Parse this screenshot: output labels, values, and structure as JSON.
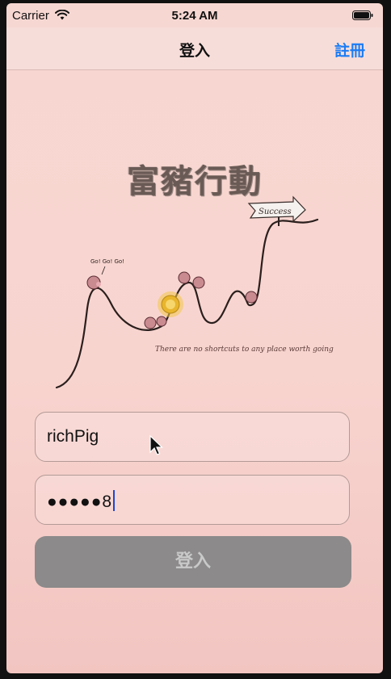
{
  "status_bar": {
    "carrier": "Carrier",
    "time": "5:24 AM",
    "wifi_icon": "wifi-icon",
    "battery_icon": "battery-icon"
  },
  "nav": {
    "title": "登入",
    "register_label": "註冊"
  },
  "illustration": {
    "title": "富豬行動",
    "sign_text": "Success",
    "speech_text": "Go! Go! Go!",
    "motto": "There are no shortcuts to any place worth going"
  },
  "form": {
    "username_value": "richPig",
    "password_value": "●●●●●8",
    "login_label": "登入"
  },
  "colors": {
    "background": "#f7d7d2",
    "accent": "#1a7cf5",
    "button": "#8c8a8a",
    "button_text": "#c9c9c9"
  }
}
